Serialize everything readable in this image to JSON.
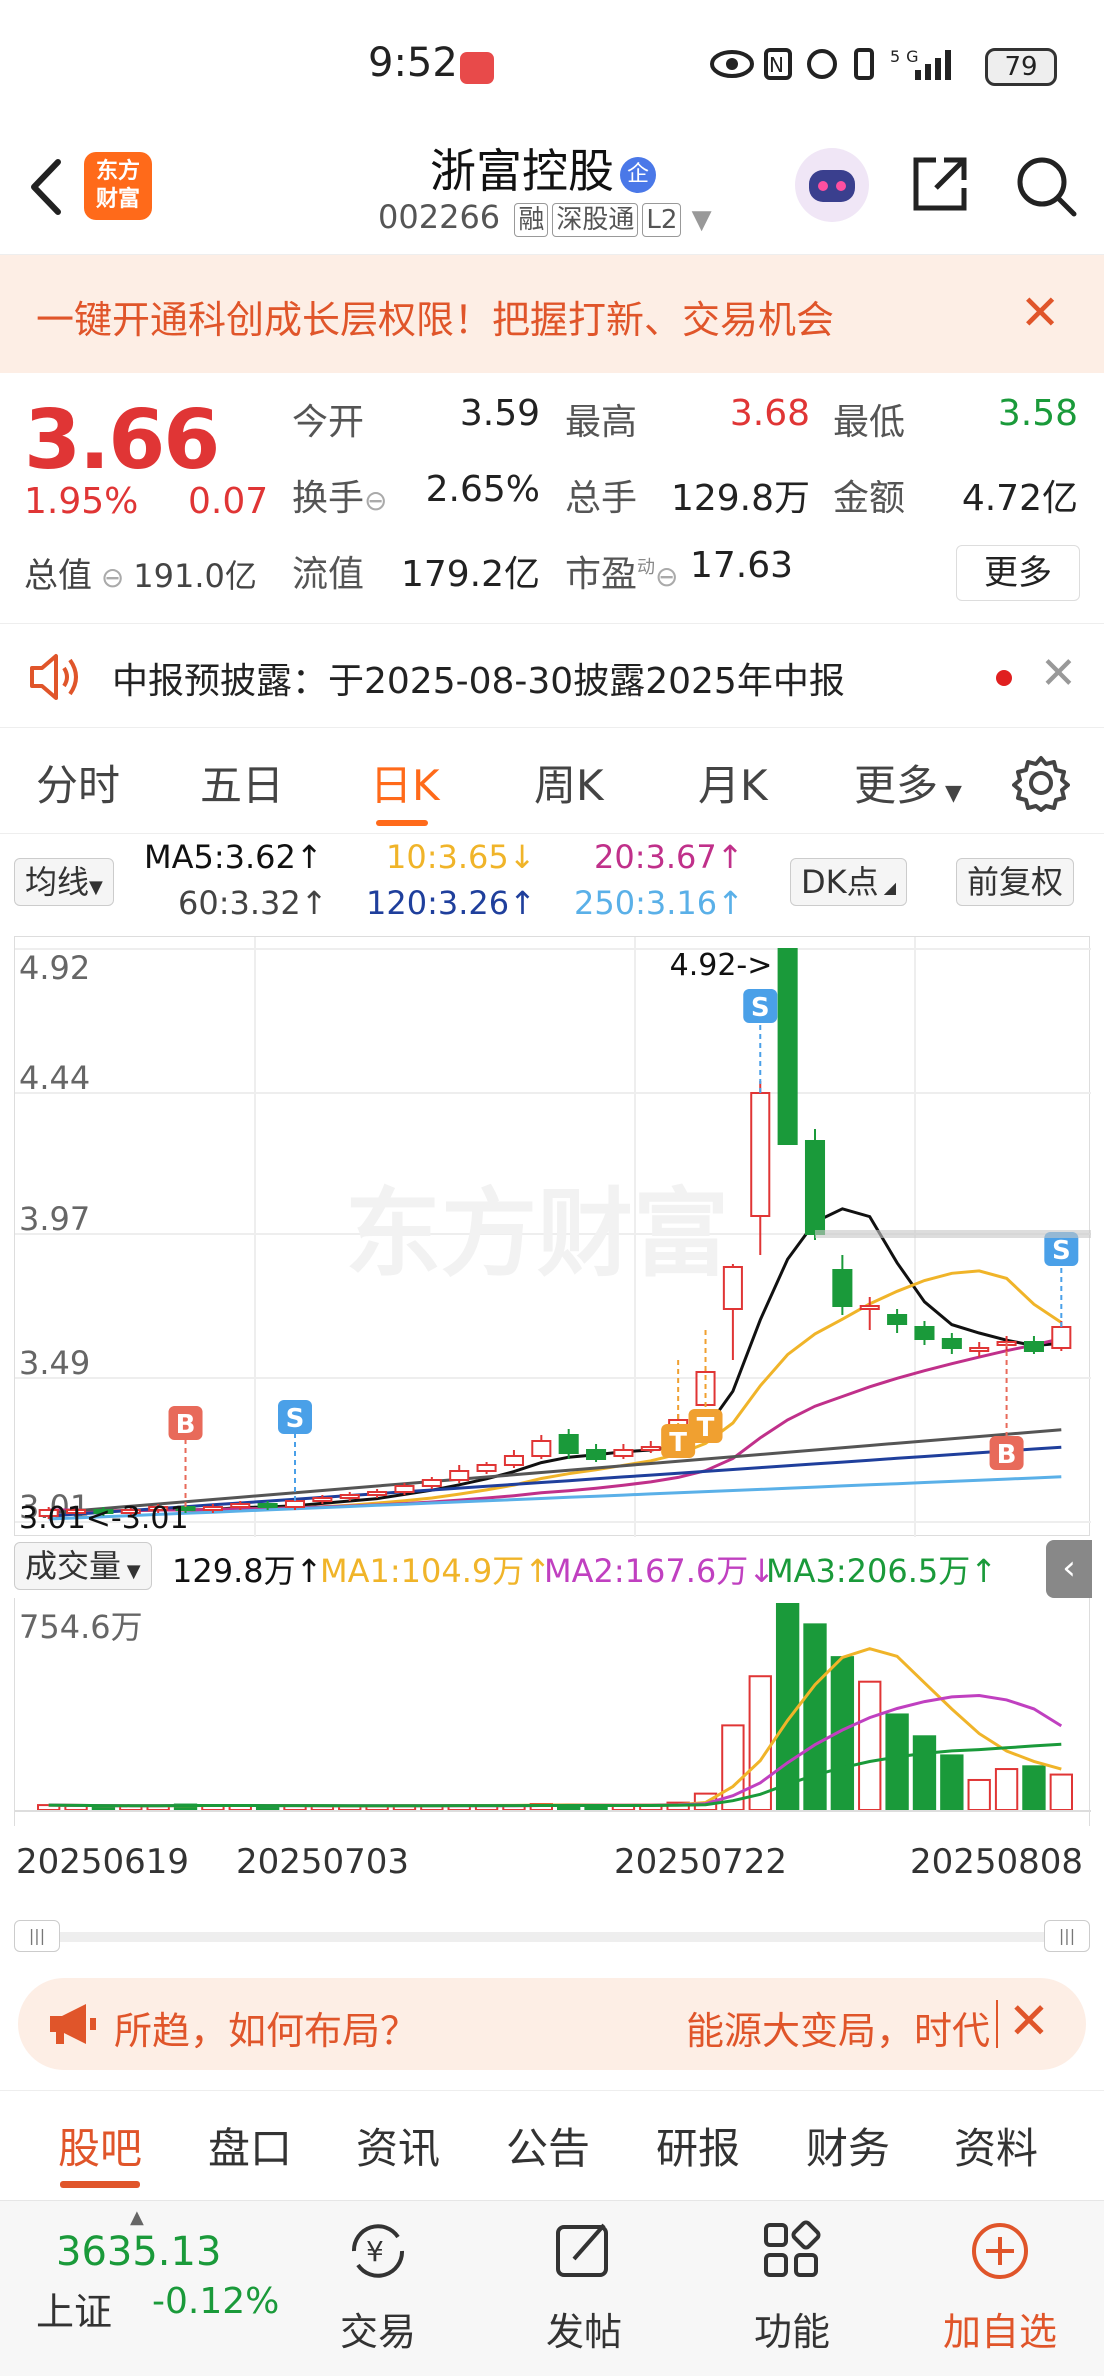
{
  "status": {
    "time": "9:52",
    "battery": "79",
    "signal_label": "5G"
  },
  "header": {
    "app_logo": "东方\n财富",
    "stock_name": "浙富控股",
    "ent_badge": "企",
    "stock_code": "002266",
    "tags": [
      "融",
      "深股通",
      "L2"
    ]
  },
  "promo": {
    "text": "一键开通科创成长层权限！把握打新、交易机会"
  },
  "quote": {
    "price": "3.66",
    "pct": "1.95%",
    "change": "0.07",
    "total_value_label": "总值",
    "total_value": "191.0亿",
    "rows": [
      [
        {
          "label": "今开",
          "value": "3.59",
          "color": "#222"
        },
        {
          "label": "最高",
          "value": "3.68",
          "color": "#e03535"
        },
        {
          "label": "最低",
          "value": "3.58",
          "color": "#1a9a3a"
        }
      ],
      [
        {
          "label": "换手",
          "value": "2.65%",
          "color": "#222"
        },
        {
          "label": "总手",
          "value": "129.8万",
          "color": "#222"
        },
        {
          "label": "金额",
          "value": "4.72亿",
          "color": "#222"
        }
      ],
      [
        {
          "label": "流值",
          "value": "179.2亿",
          "color": "#222"
        },
        {
          "label": "市盈",
          "value": "17.63",
          "color": "#222"
        }
      ]
    ],
    "pe_superscript": "动",
    "more": "更多"
  },
  "notice": {
    "text": "中报预披露：于2025-08-30披露2025年中报"
  },
  "chart_tabs": [
    "分时",
    "五日",
    "日K",
    "周K",
    "月K",
    "更多"
  ],
  "chart_tabs_active": "日K",
  "ma_legend": {
    "selector": "均线",
    "ma5": "MA5:3.62↑",
    "ma10": "10:3.65↓",
    "ma20": "20:3.67↑",
    "ma60": "60:3.32↑",
    "ma120": "120:3.26↑",
    "ma250": "250:3.16↑",
    "dk": "DK点",
    "adjust": "前复权",
    "colors": {
      "ma5": "#111111",
      "ma10": "#f0b429",
      "ma20": "#c0308a",
      "ma60": "#555555",
      "ma120": "#1f3f9c",
      "ma250": "#5ab0e8"
    }
  },
  "kline": {
    "y_ticks": [
      "4.92",
      "4.44",
      "3.97",
      "3.49",
      "3.01"
    ],
    "max_label": "4.92->",
    "min_label": "3.01<-3.01",
    "watermark": "东方财富",
    "markers": [
      "B",
      "S",
      "S",
      "T",
      "T",
      "B",
      "S"
    ]
  },
  "volume": {
    "selector": "成交量",
    "current": "129.8万↑",
    "ma1": "MA1:104.9万↑",
    "ma2": "MA2:167.6万↓",
    "ma3": "MA3:206.5万↑",
    "max_label": "754.6万",
    "colors": {
      "ma1": "#f0b429",
      "ma2": "#c040c0",
      "ma3": "#1a9a3a"
    }
  },
  "dates": [
    "20250619",
    "20250703",
    "20250722",
    "20250808"
  ],
  "chart_data": {
    "type": "candlestick",
    "y_range": [
      3.01,
      4.92
    ],
    "candles": [
      {
        "o": 3.03,
        "c": 3.05,
        "h": 3.06,
        "l": 3.02
      },
      {
        "o": 3.04,
        "c": 3.05,
        "h": 3.06,
        "l": 3.03
      },
      {
        "o": 3.05,
        "c": 3.04,
        "h": 3.06,
        "l": 3.03
      },
      {
        "o": 3.04,
        "c": 3.05,
        "h": 3.06,
        "l": 3.03
      },
      {
        "o": 3.05,
        "c": 3.06,
        "h": 3.07,
        "l": 3.04
      },
      {
        "o": 3.06,
        "c": 3.05,
        "h": 3.07,
        "l": 3.04
      },
      {
        "o": 3.05,
        "c": 3.06,
        "h": 3.07,
        "l": 3.04
      },
      {
        "o": 3.06,
        "c": 3.07,
        "h": 3.08,
        "l": 3.05
      },
      {
        "o": 3.07,
        "c": 3.06,
        "h": 3.08,
        "l": 3.05
      },
      {
        "o": 3.06,
        "c": 3.08,
        "h": 3.09,
        "l": 3.05
      },
      {
        "o": 3.08,
        "c": 3.09,
        "h": 3.1,
        "l": 3.07
      },
      {
        "o": 3.09,
        "c": 3.1,
        "h": 3.11,
        "l": 3.08
      },
      {
        "o": 3.1,
        "c": 3.11,
        "h": 3.12,
        "l": 3.09
      },
      {
        "o": 3.11,
        "c": 3.13,
        "h": 3.14,
        "l": 3.1
      },
      {
        "o": 3.13,
        "c": 3.15,
        "h": 3.16,
        "l": 3.12
      },
      {
        "o": 3.15,
        "c": 3.18,
        "h": 3.2,
        "l": 3.14
      },
      {
        "o": 3.18,
        "c": 3.2,
        "h": 3.21,
        "l": 3.17
      },
      {
        "o": 3.2,
        "c": 3.23,
        "h": 3.25,
        "l": 3.19
      },
      {
        "o": 3.23,
        "c": 3.28,
        "h": 3.3,
        "l": 3.22
      },
      {
        "o": 3.3,
        "c": 3.24,
        "h": 3.32,
        "l": 3.22
      },
      {
        "o": 3.25,
        "c": 3.22,
        "h": 3.27,
        "l": 3.21
      },
      {
        "o": 3.23,
        "c": 3.25,
        "h": 3.27,
        "l": 3.22
      },
      {
        "o": 3.25,
        "c": 3.26,
        "h": 3.28,
        "l": 3.24
      },
      {
        "o": 3.26,
        "c": 3.35,
        "h": 3.37,
        "l": 3.26
      },
      {
        "o": 3.4,
        "c": 3.51,
        "h": 3.52,
        "l": 3.4
      },
      {
        "o": 3.72,
        "c": 3.86,
        "h": 3.87,
        "l": 3.55
      },
      {
        "o": 4.03,
        "c": 4.44,
        "h": 4.48,
        "l": 3.9
      },
      {
        "o": 4.92,
        "c": 4.27,
        "h": 4.92,
        "l": 4.27
      },
      {
        "o": 4.28,
        "c": 3.97,
        "h": 4.32,
        "l": 3.95
      },
      {
        "o": 3.85,
        "c": 3.73,
        "h": 3.9,
        "l": 3.7
      },
      {
        "o": 3.72,
        "c": 3.73,
        "h": 3.76,
        "l": 3.65
      },
      {
        "o": 3.7,
        "c": 3.67,
        "h": 3.72,
        "l": 3.64
      },
      {
        "o": 3.66,
        "c": 3.62,
        "h": 3.68,
        "l": 3.6
      },
      {
        "o": 3.62,
        "c": 3.59,
        "h": 3.64,
        "l": 3.57
      },
      {
        "o": 3.58,
        "c": 3.59,
        "h": 3.61,
        "l": 3.56
      },
      {
        "o": 3.6,
        "c": 3.61,
        "h": 3.63,
        "l": 3.58
      },
      {
        "o": 3.61,
        "c": 3.58,
        "h": 3.63,
        "l": 3.57
      },
      {
        "o": 3.59,
        "c": 3.66,
        "h": 3.68,
        "l": 3.58
      }
    ],
    "volumes": [
      18,
      16,
      14,
      15,
      16,
      20,
      17,
      15,
      14,
      16,
      15,
      14,
      15,
      17,
      16,
      18,
      17,
      16,
      22,
      20,
      17,
      15,
      18,
      27,
      60,
      310,
      490,
      754.6,
      680,
      560,
      470,
      350,
      270,
      200,
      110,
      150,
      160,
      129.8
    ]
  },
  "ad": {
    "left": "所趋，如何布局？",
    "right": "能源大变局，时代"
  },
  "sub_tabs": [
    "股吧",
    "盘口",
    "资讯",
    "公告",
    "研报",
    "财务",
    "资料"
  ],
  "sub_tabs_active": "股吧",
  "bottom": {
    "index_value": "3635.13",
    "index_name": "上证",
    "index_pct": "-0.12%",
    "items": [
      {
        "label": "交易",
        "color": "#333"
      },
      {
        "label": "发帖",
        "color": "#333"
      },
      {
        "label": "功能",
        "color": "#333"
      },
      {
        "label": "加自选",
        "color": "#e0552a"
      }
    ]
  }
}
